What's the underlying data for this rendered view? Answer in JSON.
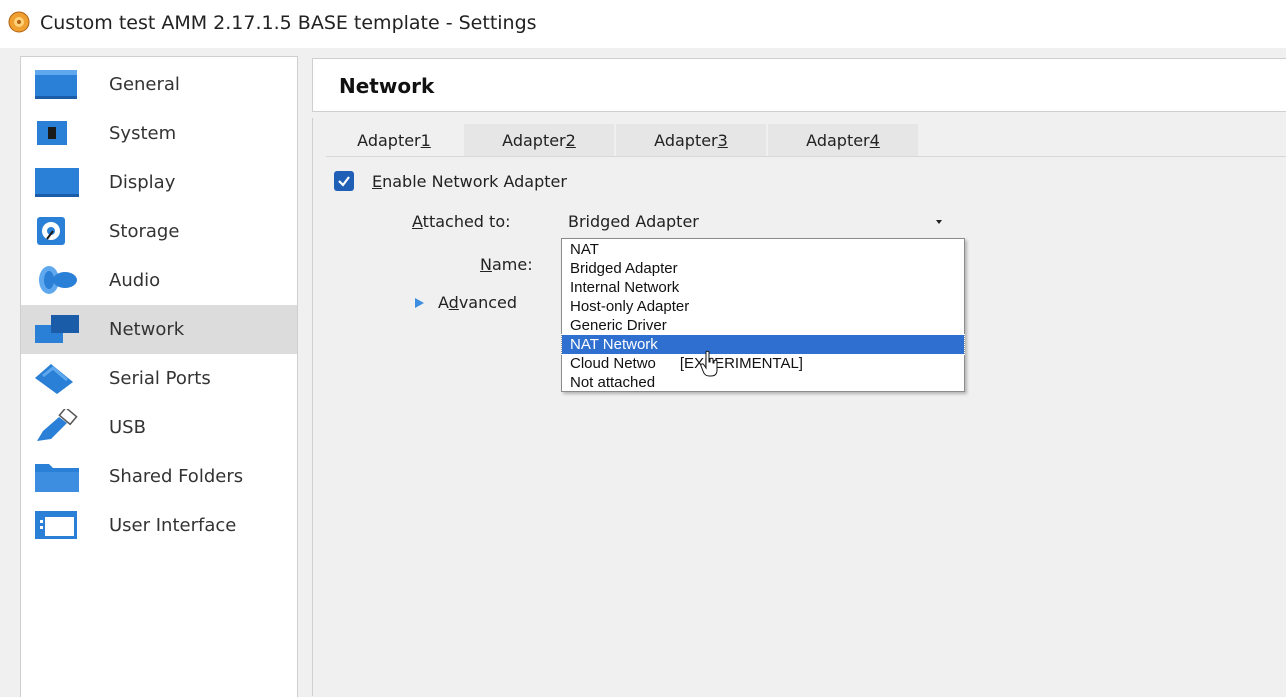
{
  "window": {
    "title": "Custom test AMM 2.17.1.5 BASE template - Settings"
  },
  "sidebar": {
    "selected": "Network",
    "items": [
      {
        "label": "General",
        "icon": "general-icon"
      },
      {
        "label": "System",
        "icon": "system-icon"
      },
      {
        "label": "Display",
        "icon": "display-icon"
      },
      {
        "label": "Storage",
        "icon": "storage-icon"
      },
      {
        "label": "Audio",
        "icon": "audio-icon"
      },
      {
        "label": "Network",
        "icon": "network-icon"
      },
      {
        "label": "Serial Ports",
        "icon": "serial-ports-icon"
      },
      {
        "label": "USB",
        "icon": "usb-icon"
      },
      {
        "label": "Shared Folders",
        "icon": "shared-folders-icon"
      },
      {
        "label": "User Interface",
        "icon": "user-interface-icon"
      }
    ]
  },
  "main": {
    "title": "Network",
    "tabs": [
      {
        "prefix": "Adapter ",
        "key": "1"
      },
      {
        "prefix": "Adapter ",
        "key": "2"
      },
      {
        "prefix": "Adapter ",
        "key": "3"
      },
      {
        "prefix": "Adapter ",
        "key": "4"
      }
    ],
    "active_tab": "Adapter 1",
    "enable_adapter": {
      "key": "E",
      "rest": "nable Network Adapter",
      "checked": true
    },
    "attached_to": {
      "key": "A",
      "rest": "ttached to:",
      "value": "Bridged Adapter"
    },
    "name": {
      "key": "N",
      "rest": "ame:"
    },
    "advanced": {
      "pre": "A",
      "key": "d",
      "rest": "vanced"
    },
    "dropdown": {
      "options": [
        "NAT",
        "Bridged Adapter",
        "Internal Network",
        "Host-only Adapter",
        "Generic Driver",
        "NAT Network",
        "Cloud Netwo",
        "Not attached"
      ],
      "cloud_suffix": "[EXPERIMENTAL]",
      "highlighted": "NAT Network"
    }
  },
  "colors": {
    "accent": "#1f5fb5",
    "highlight": "#2f6fd0",
    "selected_sidebar": "#dcdcdc"
  }
}
